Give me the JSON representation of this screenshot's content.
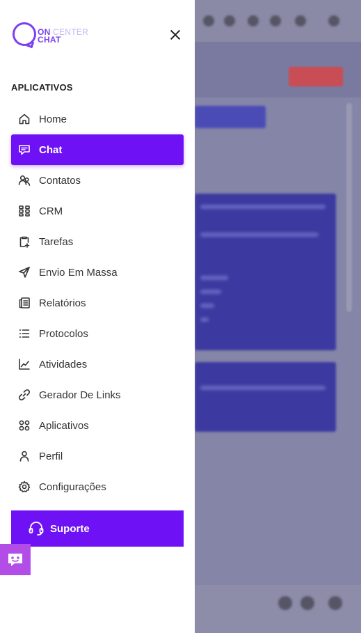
{
  "logo": {
    "part_on": "ON",
    "part_center": "CENTER",
    "part_chat": "CHAT"
  },
  "section_title": "APLICATIVOS",
  "menu": [
    {
      "label": "Home",
      "icon": "home-icon",
      "active": false
    },
    {
      "label": "Chat",
      "icon": "chat-icon",
      "active": true
    },
    {
      "label": "Contatos",
      "icon": "contacts-icon",
      "active": false
    },
    {
      "label": "CRM",
      "icon": "crm-icon",
      "active": false
    },
    {
      "label": "Tarefas",
      "icon": "tasks-icon",
      "active": false
    },
    {
      "label": "Envio Em Massa",
      "icon": "send-icon",
      "active": false
    },
    {
      "label": "Relatórios",
      "icon": "reports-icon",
      "active": false
    },
    {
      "label": "Protocolos",
      "icon": "list-icon",
      "active": false
    },
    {
      "label": "Atividades",
      "icon": "activity-chart-icon",
      "active": false
    },
    {
      "label": "Gerador De Links",
      "icon": "link-icon",
      "active": false
    },
    {
      "label": "Aplicativos",
      "icon": "apps-icon",
      "active": false
    },
    {
      "label": "Perfil",
      "icon": "user-icon",
      "active": false
    },
    {
      "label": "Configurações",
      "icon": "gear-icon",
      "active": false
    }
  ],
  "support_label": "Suporte",
  "colors": {
    "accent": "#6e12f5",
    "bot": "#b34de8",
    "overlay": "#7a7aa0"
  }
}
